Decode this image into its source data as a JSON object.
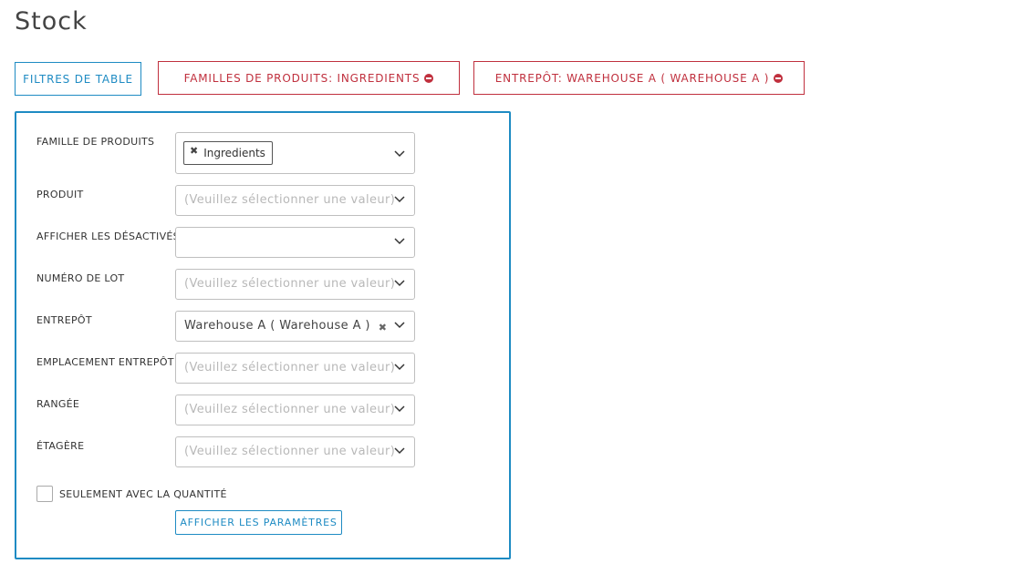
{
  "page": {
    "title": "Stock"
  },
  "chips": {
    "table_filters": "FILTRES DE TABLE",
    "product_family": "FAMILLES DE PRODUITS: INGREDIENTS",
    "warehouse": "ENTREPÔT: WAREHOUSE A ( WAREHOUSE A )"
  },
  "filters": {
    "product_family": {
      "label": "FAMILLE DE PRODUITS",
      "tags": [
        "Ingredients"
      ]
    },
    "product": {
      "label": "PRODUIT",
      "placeholder": "(Veuillez sélectionner une valeur)"
    },
    "show_disabled": {
      "label": "AFFICHER LES DÉSACTIVÉS",
      "value": ""
    },
    "lot_number": {
      "label": "NUMÉRO DE LOT",
      "placeholder": "(Veuillez sélectionner une valeur)"
    },
    "warehouse": {
      "label": "ENTREPÔT",
      "value": "Warehouse A ( Warehouse A )"
    },
    "warehouse_location": {
      "label": "EMPLACEMENT ENTREPÔT",
      "placeholder": "(Veuillez sélectionner une valeur)"
    },
    "row": {
      "label": "RANGÉE",
      "placeholder": "(Veuillez sélectionner une valeur)"
    },
    "shelf": {
      "label": "ÉTAGÈRE",
      "placeholder": "(Veuillez sélectionner une valeur)"
    },
    "only_with_quantity": {
      "label": "SEULEMENT AVEC LA QUANTITÉ",
      "checked": false
    },
    "show_params_label": "AFFICHER LES PARAMÈTRES"
  },
  "colors": {
    "accent": "#1e8bc3",
    "danger": "#c0303e"
  },
  "icons": [
    "remove-filter-icon",
    "chevron-down-icon",
    "clear-icon",
    "tag-remove-icon"
  ]
}
